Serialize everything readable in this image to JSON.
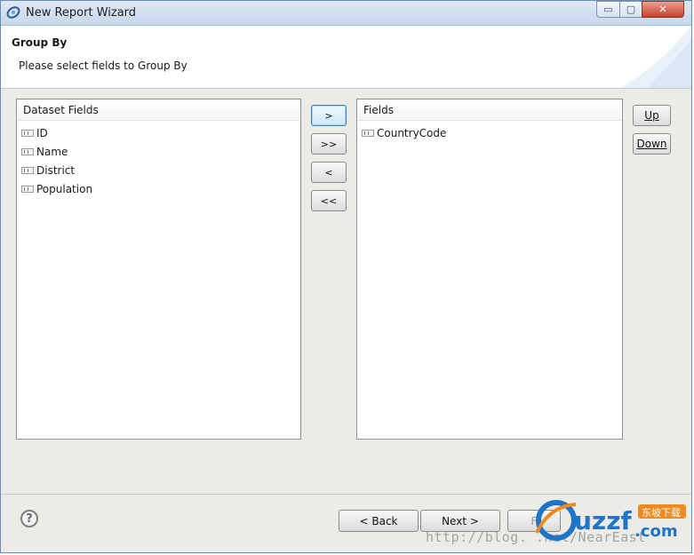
{
  "window": {
    "title": "New Report Wizard",
    "controls": {
      "minimize": "▭",
      "maximize": "▢",
      "close": "✕"
    }
  },
  "banner": {
    "title": "Group By",
    "subtitle": "Please select fields to Group By"
  },
  "dataset_panel": {
    "header": "Dataset Fields",
    "items": [
      "ID",
      "Name",
      "District",
      "Population"
    ]
  },
  "fields_panel": {
    "header": "Fields",
    "items": [
      "CountryCode"
    ]
  },
  "transfer_buttons": {
    "add": ">",
    "add_all": ">>",
    "remove": "<",
    "remove_all": "<<"
  },
  "order_buttons": {
    "up": "Up",
    "down": "Down"
  },
  "footer": {
    "help": "?",
    "back": "< Back",
    "next": "Next >",
    "finish": "F"
  },
  "watermark": {
    "url": "http://blog.   .net/NearEast",
    "logo_text": "uzzf",
    "logo_suffix": ".com",
    "logo_badge": "东坡下载"
  },
  "colors": {
    "accent": "#3c7fb1",
    "logo_blue": "#1e74c9",
    "logo_orange": "#f08a1c"
  }
}
